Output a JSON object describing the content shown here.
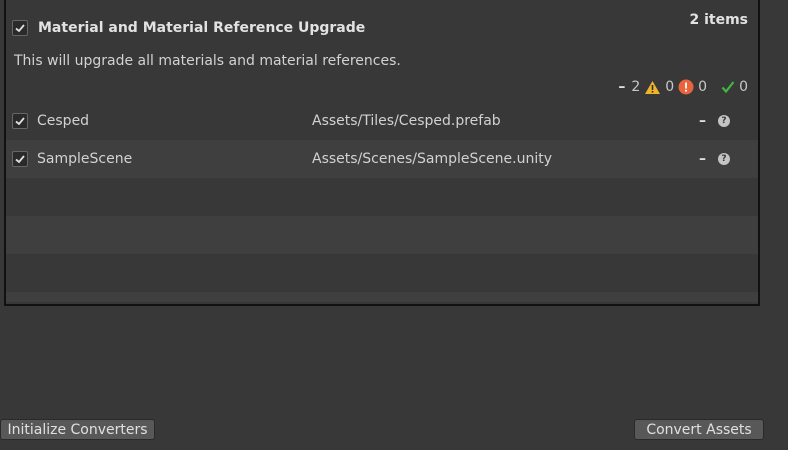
{
  "converter": {
    "title": "Material and Material Reference Upgrade",
    "count": "2 items",
    "description": "This will upgrade all materials and material references.",
    "stats": {
      "pending": "2",
      "warnings": "0",
      "errors": "0",
      "success": "0"
    }
  },
  "items": [
    {
      "name": "Cesped",
      "path": "Assets/Tiles/Cesped.prefab",
      "status": "–",
      "help": "?"
    },
    {
      "name": "SampleScene",
      "path": "Assets/Scenes/SampleScene.unity",
      "status": "–",
      "help": "?"
    }
  ],
  "buttons": {
    "initialize": "Initialize Converters",
    "convert": "Convert Assets"
  },
  "colors": {
    "warning": "#f0b429",
    "error": "#e8643c",
    "success": "#3fb93f"
  }
}
